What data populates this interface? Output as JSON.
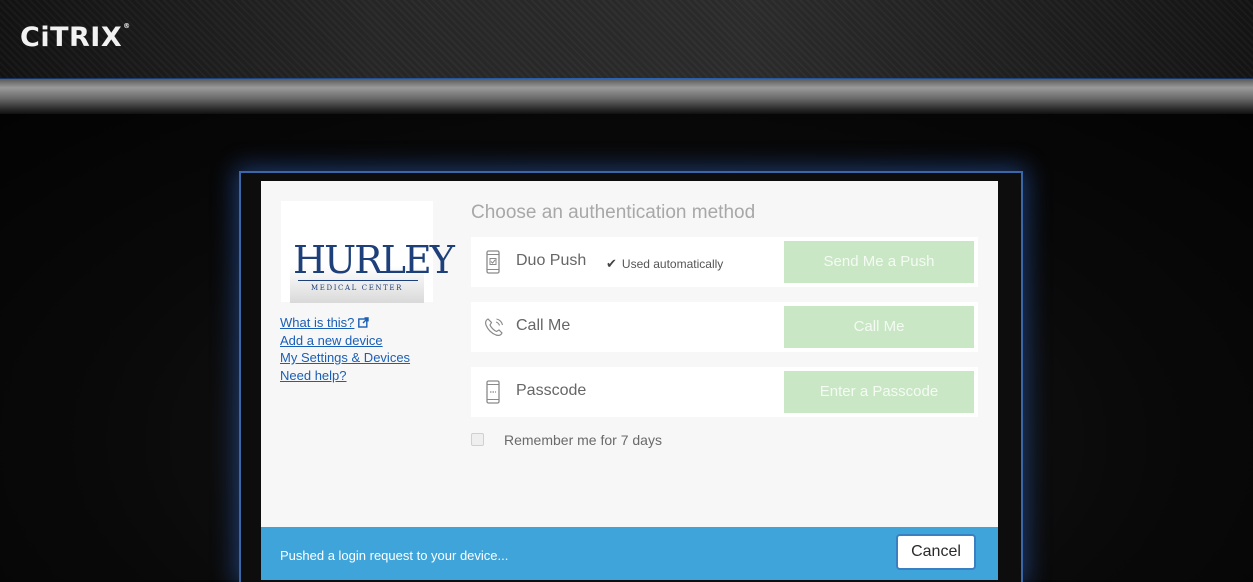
{
  "brand": {
    "name": "CiTRIX",
    "mark": "®"
  },
  "logo": {
    "name": "HURLEY",
    "subtitle": "MEDICAL CENTER"
  },
  "links": [
    {
      "label": "What is this?"
    },
    {
      "label": "Add a new device"
    },
    {
      "label": "My Settings & Devices"
    },
    {
      "label": "Need help?"
    }
  ],
  "heading": "Choose an authentication method",
  "methods": [
    {
      "label": "Duo Push",
      "note": "Used automatically",
      "button": "Send Me a Push",
      "icon": "phone-check-icon"
    },
    {
      "label": "Call Me",
      "button": "Call Me",
      "icon": "phone-call-icon"
    },
    {
      "label": "Passcode",
      "button": "Enter a Passcode",
      "icon": "phone-passcode-icon"
    }
  ],
  "remember_label": "Remember me for 7 days",
  "status": {
    "message": "Pushed a login request to your device...",
    "cancel_label": "Cancel"
  },
  "colors": {
    "status_bar": "#3ea4d9",
    "button_disabled": "#c9e6c5",
    "link": "#1a5fb5",
    "frame_glow": "#3b66a8"
  }
}
